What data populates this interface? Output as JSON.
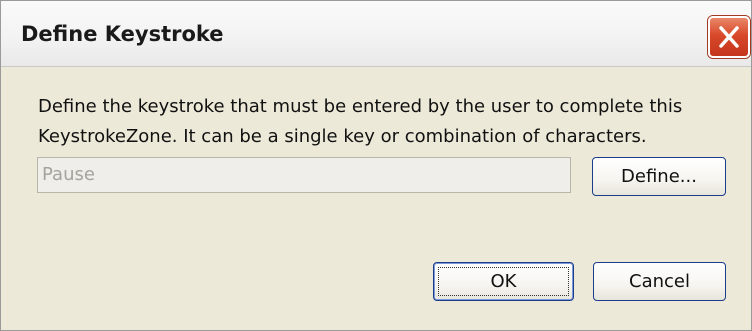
{
  "dialog": {
    "title": "Define Keystroke",
    "message_line1": "Define the keystroke that must be entered by the user to complete this",
    "message_line2": "KeystrokeZone. It can be a single key or combination of characters.",
    "keystroke_value": "Pause",
    "define_label": "Define...",
    "ok_label": "OK",
    "cancel_label": "Cancel",
    "close_icon": "close-icon"
  },
  "colors": {
    "dialog_background": "#ece9d8",
    "close_button": "#d9482a",
    "button_border": "#1c3c8c",
    "disabled_text": "#a4a39c"
  }
}
